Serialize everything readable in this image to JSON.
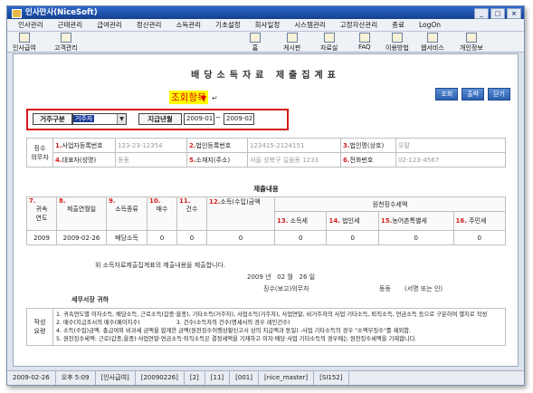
{
  "window": {
    "title": "인사만사(NiceSoft)"
  },
  "menu": [
    "인사관리",
    "근태관리",
    "급여관리",
    "정산관리",
    "소득관리",
    "기초설정",
    "회사일정",
    "시스템관리",
    "고정자산관리",
    "종료",
    "LogOn"
  ],
  "toolbar": [
    "인사급여",
    "고객관리",
    "홈",
    "게시판",
    "자료실",
    "FAQ",
    "이용방법",
    "웹서비스",
    "개인정보"
  ],
  "page": {
    "title": "배당소득자료 제출집계표",
    "query_label": "조회항목",
    "buttons": [
      "조회",
      "출력",
      "닫기"
    ]
  },
  "filter": {
    "type_label": "거주구분",
    "type_value": "거주자",
    "date_label": "지급년월",
    "date_from": "2009-01",
    "date_sep": "~",
    "date_to": "2009-02"
  },
  "payer": {
    "side_label": "징수\n의무자",
    "f1_num": "1.",
    "f1_label": "사업자등록번호",
    "f1_value": "123-23-12354",
    "f2_num": "2.",
    "f2_label": "법인등록번호",
    "f2_value": "123415-2124151",
    "f3_num": "3.",
    "f3_label": "법인명(상호)",
    "f3_value": "오말",
    "f4_num": "4.",
    "f4_label": "대표자(성명)",
    "f4_value": "동동",
    "f5_num": "5.",
    "f5_label": "소재지(주소)",
    "f5_value": "서울 성북구 길음동 1233",
    "f6_num": "6.",
    "f6_label": "전화번호",
    "f6_value": "02-123-4567"
  },
  "submit": {
    "section_title": "제출내용",
    "h7_num": "7.",
    "h7_label": "귀속\n연도",
    "h8_num": "8.",
    "h8_label": "제출연월일",
    "h9_num": "9.",
    "h9_label": "소득종류",
    "h10_num": "10.",
    "h10_label": "매수",
    "h11_num": "11.",
    "h11_label": "건수",
    "h12_num": "12.",
    "h12_label": "소득(수입)금액",
    "withholding_title": "원천징수세액",
    "h13_num": "13.",
    "h13_label": "소득세",
    "h14_num": "14.",
    "h14_label": "법인세",
    "h15_num": "15.",
    "h15_label": "농어촌특별세",
    "h16_num": "16.",
    "h16_label": "주민세",
    "row": {
      "year": "2009",
      "date": "2009-02-26",
      "kind": "배당소득",
      "sheets": "0",
      "count": "0",
      "amount": "0",
      "income_tax": "0",
      "corp_tax": "0",
      "rural_tax": "0",
      "resident_tax": "0"
    }
  },
  "declaration": {
    "text": "위 소득자료제출집계표의 제출내용을 제출합니다.",
    "year": "2009",
    "year_unit": "년",
    "month": "02",
    "month_unit": "월",
    "day": "26",
    "day_unit": "일",
    "reporter_label": "징수(보고)의무자",
    "reporter_name": "동동",
    "sign_label": "(서명 또는 인)",
    "office": "세무서장 귀하"
  },
  "notes": {
    "side_label": "작성\n요령",
    "n1": "1. 귀속연도별 이자소득, 배당소득, 근로소득(갑종·을종), 기타소득(거주자), 사업소득(거주자), 사업연말, 비거주자의 사업·기타소득, 퇴직소득, 연금소득 등으로 구분하여 별지로 작성",
    "n2": "2. 매수(지급조서의 매수(페이지수)",
    "n3": "3. 건수(소득자의 건수(명세서의 경우 레인건수)",
    "n4": "4. 소득(수입)금액: 총급여와 비과세 금액을 합계한 금액(원천징수이행상황신고서 상의 지급액과 동일) -사업 기타소득의 경우 \"소액부징수\"를 제외함.",
    "n5": "5. 원천징수세액: 근로(갑종,을종)·사업연말·연금소득·퇴직소득은 결정세액을 기재하고 이자·배당·사업 기타소득의 경우에는 원천징수세액을 기재합니다."
  },
  "status": [
    "2009-02-26",
    "오후 5:09",
    "[인사급여]",
    "[20090226]",
    "[2]",
    "[11]",
    "[001]",
    "[nice_master]",
    "[SI152]"
  ]
}
